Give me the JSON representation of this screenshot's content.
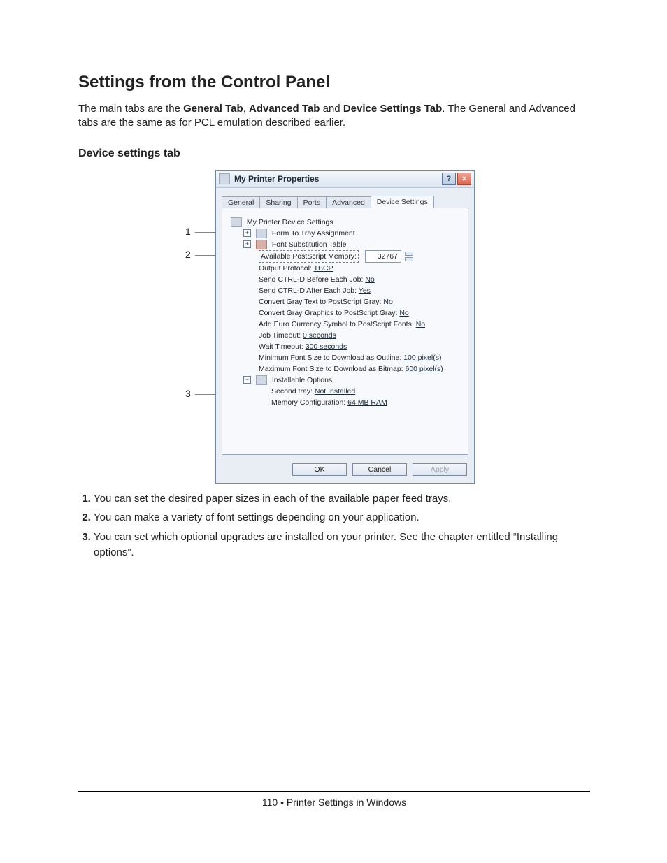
{
  "heading": "Settings from the Control Panel",
  "intro": {
    "prefix": "The main tabs are the ",
    "t1": "General Tab",
    "sep1": ", ",
    "t2": "Advanced Tab",
    "sep2": " and ",
    "t3": "Device Settings Tab",
    "suffix": ". The General and Advanced tabs are the same as for PCL emulation described earlier."
  },
  "subheading": "Device settings tab",
  "dialog": {
    "title": "My Printer Properties",
    "help_btn": "?",
    "close_btn": "×",
    "tabs": {
      "general": "General",
      "sharing": "Sharing",
      "ports": "Ports",
      "advanced": "Advanced",
      "device": "Device Settings"
    },
    "tree": {
      "root": "My Printer Device Settings",
      "form_to_tray": "Form To Tray Assignment",
      "font_sub": "Font Substitution Table",
      "ps_mem_label": "Available PostScript Memory:",
      "ps_mem_value": "32767",
      "output_proto_label": "Output Protocol: ",
      "output_proto_value": "TBCP",
      "ctrl_d_before_label": "Send CTRL-D Before Each Job: ",
      "ctrl_d_before_value": "No",
      "ctrl_d_after_label": "Send CTRL-D After Each Job: ",
      "ctrl_d_after_value": "Yes",
      "gray_text_label": "Convert Gray Text to PostScript Gray: ",
      "gray_text_value": "No",
      "gray_gfx_label": "Convert Gray Graphics to PostScript Gray: ",
      "gray_gfx_value": "No",
      "euro_label": "Add Euro Currency Symbol to PostScript Fonts: ",
      "euro_value": "No",
      "job_timeout_label": "Job Timeout: ",
      "job_timeout_value": "0 seconds",
      "wait_timeout_label": "Wait Timeout: ",
      "wait_timeout_value": "300 seconds",
      "min_font_label": "Minimum Font Size to Download as Outline: ",
      "min_font_value": "100 pixel(s)",
      "max_font_label": "Maximum Font Size to Download as Bitmap: ",
      "max_font_value": "600 pixel(s)",
      "installable": "Installable Options",
      "second_tray_label": "Second tray: ",
      "second_tray_value": "Not Installed",
      "mem_cfg_label": "Memory Configuration: ",
      "mem_cfg_value": "64 MB RAM"
    },
    "buttons": {
      "ok": "OK",
      "cancel": "Cancel",
      "apply": "Apply"
    }
  },
  "callouts": {
    "c1": "1",
    "c2": "2",
    "c3": "3"
  },
  "steps": {
    "s1": "You can set the desired paper sizes in each of the available paper feed trays.",
    "s2": "You can make a variety of font settings depending on your application.",
    "s3": "You can set which optional upgrades are installed on your printer. See the chapter entitled “Installing options”."
  },
  "footer": {
    "page_no": "110",
    "bullet": " • ",
    "section": "Printer Settings in Windows"
  }
}
